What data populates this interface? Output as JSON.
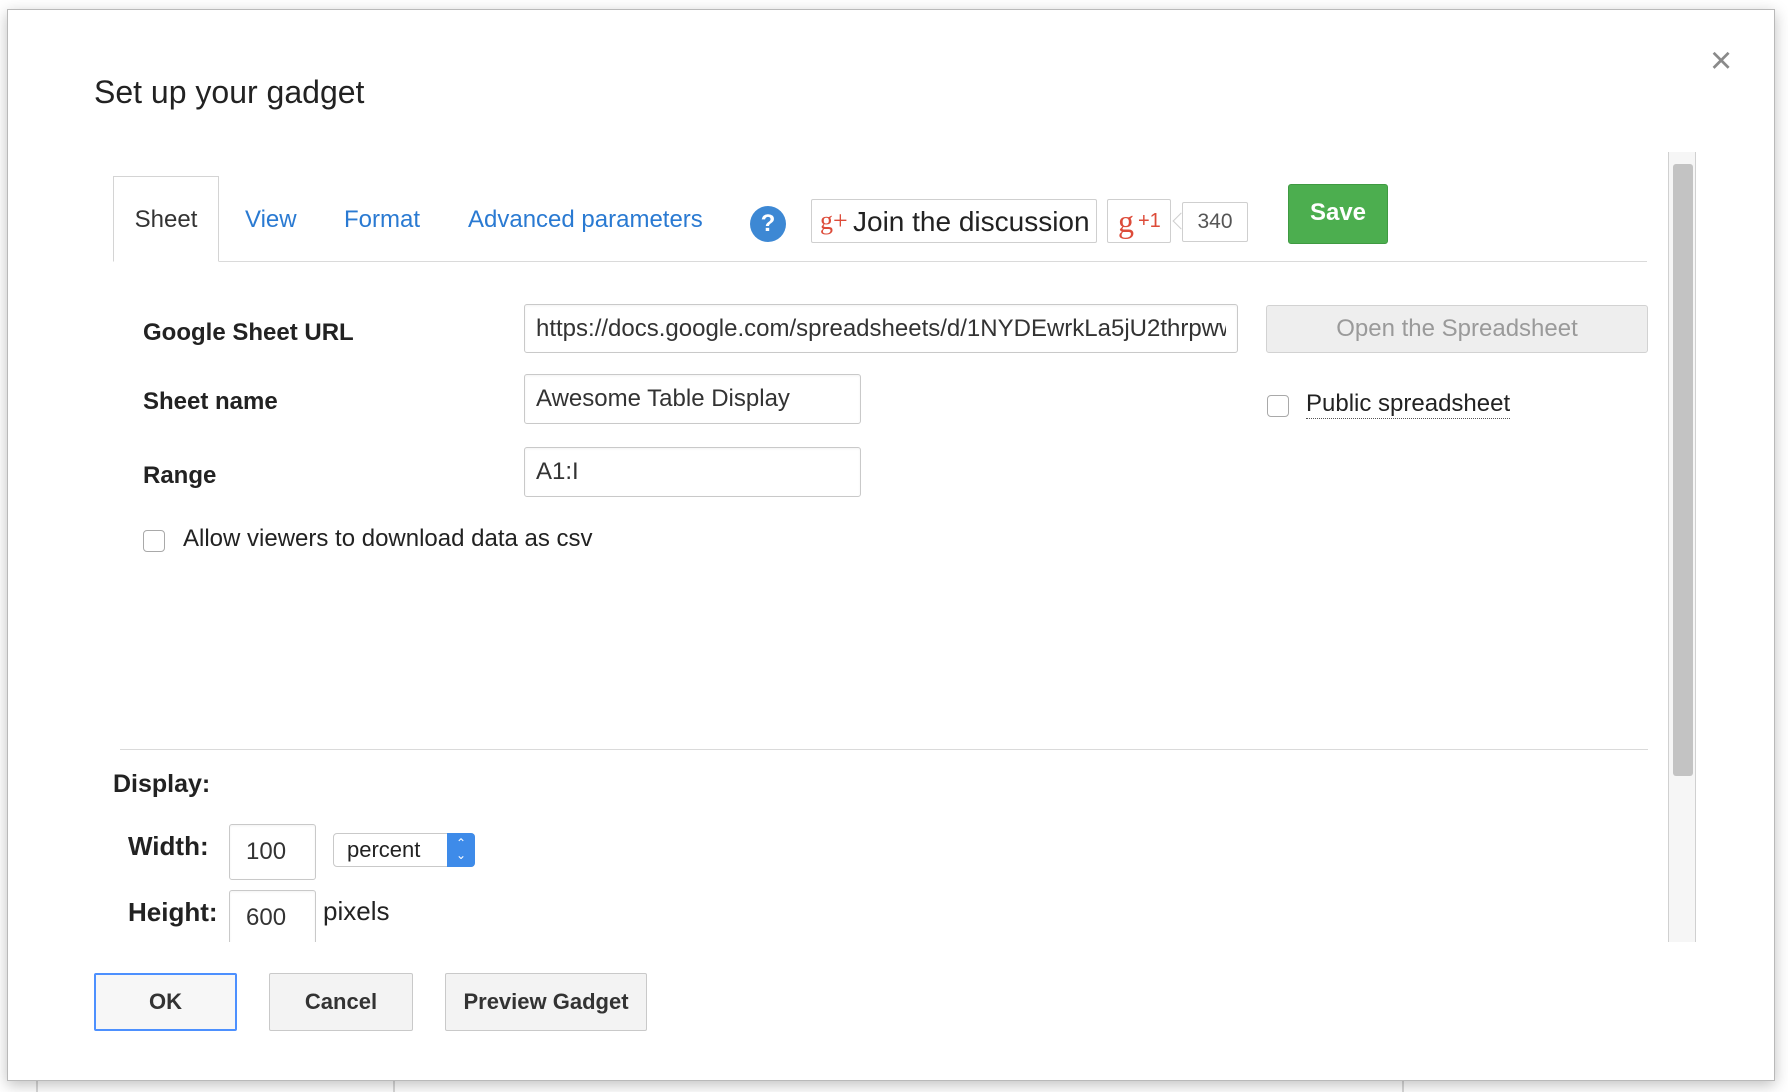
{
  "dialog": {
    "title": "Set up your gadget",
    "close_label": "×"
  },
  "tabs": [
    {
      "label": "Sheet",
      "active": true
    },
    {
      "label": "View",
      "active": false
    },
    {
      "label": "Format",
      "active": false
    },
    {
      "label": "Advanced parameters",
      "active": false
    }
  ],
  "header": {
    "help_label": "?",
    "join_icon": "g+",
    "join_label": "Join the discussion",
    "gplus_g": "g",
    "gplus_p": "+1",
    "plus_count": "340",
    "save_label": "Save"
  },
  "sheet": {
    "url_label": "Google Sheet URL",
    "url_value": "https://docs.google.com/spreadsheets/d/1NYDEwrkLa5jU2thrpww",
    "open_label": "Open the Spreadsheet",
    "name_label": "Sheet name",
    "name_value": "Awesome Table Display",
    "public_label": "Public spreadsheet",
    "range_label": "Range",
    "range_value": "A1:I",
    "csv_label": "Allow viewers to download data as csv"
  },
  "display": {
    "heading": "Display:",
    "width_label": "Width:",
    "width_value": "100",
    "width_unit": "percent",
    "height_label": "Height:",
    "height_value": "600",
    "height_unit": "pixels"
  },
  "footer": {
    "ok_label": "OK",
    "cancel_label": "Cancel",
    "preview_label": "Preview Gadget"
  },
  "colors": {
    "link": "#2a7ad2",
    "save_green": "#4cae4f",
    "help_blue": "#3d88d4",
    "gplus_red": "#dd4b39",
    "select_blue": "#3e8be9",
    "ok_border": "#4d90fe"
  }
}
